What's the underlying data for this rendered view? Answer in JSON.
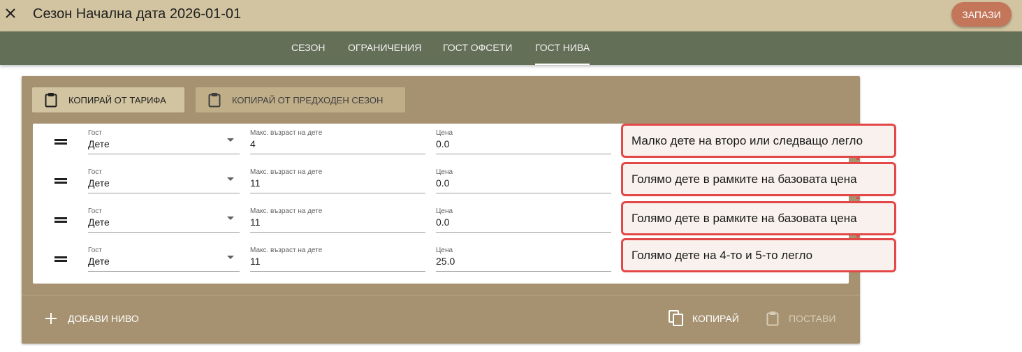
{
  "header": {
    "title": "Сезон Начална дата 2026-01-01",
    "save_label": "ЗАПАЗИ",
    "close_icon": "close-icon"
  },
  "tabs": [
    {
      "label": "СЕЗОН",
      "active": false
    },
    {
      "label": "ОГРАНИЧЕНИЯ",
      "active": false
    },
    {
      "label": "ГОСТ ОФСЕТИ",
      "active": false
    },
    {
      "label": "ГОСТ НИВА",
      "active": true
    }
  ],
  "toolbar": {
    "copy_from_tariff": "КОПИРАЙ ОТ ТАРИФА",
    "copy_from_previous": "КОПИРАЙ ОТ ПРЕДХОДЕН СЕЗОН"
  },
  "field_labels": {
    "guest": "Гост",
    "max_child_age": "Макс. възраст на дете",
    "price": "Цена"
  },
  "rows": [
    {
      "guest": "Дете",
      "max_child_age": "4",
      "price": "0.0",
      "note": "Малко дете на второ или следващо легло"
    },
    {
      "guest": "Дете",
      "max_child_age": "11",
      "price": "0.0",
      "note": "Голямо дете в рамките на базовата цена"
    },
    {
      "guest": "Дете",
      "max_child_age": "11",
      "price": "0.0",
      "note": "Голямо дете в рамките на базовата цена"
    },
    {
      "guest": "Дете",
      "max_child_age": "11",
      "price": "25.0",
      "note": "Голямо дете на 4-то и 5-то легло"
    }
  ],
  "footer": {
    "add_level": "ДОБАВИ НИВО",
    "copy": "КОПИРАЙ",
    "paste": "ПОСТАВИ"
  },
  "colors": {
    "header_bg": "#d2c4a0",
    "tabbar_bg": "#636f57",
    "card_bg": "#a69270",
    "accent_save": "#c4765a",
    "annotation_border": "#e34848"
  }
}
